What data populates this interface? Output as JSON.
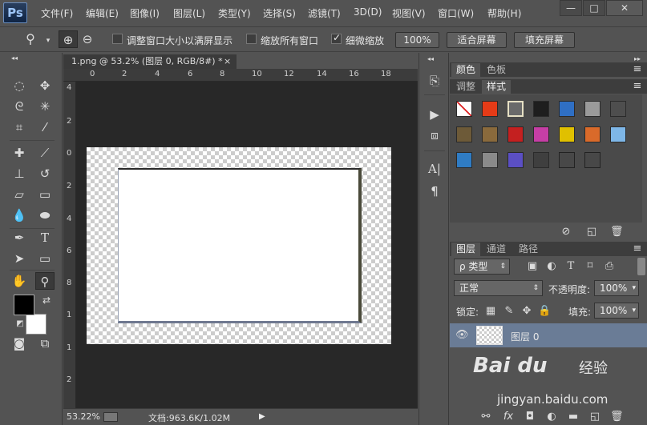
{
  "app": {
    "logo": "Ps"
  },
  "menu": [
    "文件(F)",
    "编辑(E)",
    "图像(I)",
    "图层(L)",
    "类型(Y)",
    "选择(S)",
    "滤镜(T)",
    "3D(D)",
    "视图(V)",
    "窗口(W)",
    "帮助(H)"
  ],
  "window_controls": {
    "minimize": "—",
    "maximize": "□",
    "close": "✕"
  },
  "options": {
    "resize_windows_label": "调整窗口大小以满屏显示",
    "resize_windows_checked": false,
    "zoom_all_label": "缩放所有窗口",
    "zoom_all_checked": false,
    "scrubby_zoom_label": "细微缩放",
    "scrubby_zoom_checked": true,
    "actual_pixels_button": "100%",
    "fit_screen_button": "适合屏幕",
    "fill_screen_button": "填充屏幕"
  },
  "document": {
    "tab_title": "1.png @ 53.2% (图层 0, RGB/8#) *",
    "tab_close": "×",
    "ruler_top_ticks": [
      "0",
      "2",
      "4",
      "6",
      "8",
      "10",
      "12",
      "14",
      "16",
      "18"
    ],
    "ruler_left_ticks": [
      "4",
      "2",
      "0",
      "2",
      "4",
      "6",
      "8",
      "1",
      "1",
      "2"
    ],
    "zoom_level": "53.22%",
    "doc_size": "文档:963.6K/1.02M"
  },
  "color_panel": {
    "tabs": [
      "颜色",
      "色板"
    ]
  },
  "styles_panel": {
    "tabs": [
      "调整",
      "样式"
    ],
    "swatches": [
      {
        "name": "none",
        "color": "#ffffff"
      },
      {
        "name": "glow-red",
        "color": "#e53b17"
      },
      {
        "name": "frame-grey",
        "color": "#6a6a6a"
      },
      {
        "name": "dark-button",
        "color": "#1e1e1e"
      },
      {
        "name": "blue-glass",
        "color": "#2f6fc4"
      },
      {
        "name": "silver",
        "color": "#9a9a9a"
      },
      {
        "name": "dark-metal",
        "color": "#4e4e4e"
      },
      {
        "name": "wood-dark",
        "color": "#6d5a38"
      },
      {
        "name": "wood",
        "color": "#8a6a3c"
      },
      {
        "name": "red-stripes",
        "color": "#c42020"
      },
      {
        "name": "rainbow",
        "color": "#c63ea5"
      },
      {
        "name": "gold",
        "color": "#e0c000"
      },
      {
        "name": "orange-gradient",
        "color": "#d96a2a"
      },
      {
        "name": "light-blue",
        "color": "#7eb7e8"
      },
      {
        "name": "sunset",
        "color": "#2f7cc4"
      },
      {
        "name": "checker",
        "color": "#8a8a8a"
      },
      {
        "name": "purple-blue",
        "color": "#5b4fc4"
      },
      {
        "name": "empty-dark",
        "color": "#3f3f3f"
      },
      {
        "name": "empty-outline",
        "color": "#484848"
      },
      {
        "name": "empty-outline-2",
        "color": "#484848"
      }
    ]
  },
  "layers_panel": {
    "tabs": [
      "图层",
      "通道",
      "路径"
    ],
    "filter_kind": "ρ 类型",
    "blend_mode": "正常",
    "opacity_label": "不透明度:",
    "opacity_value": "100%",
    "lock_label": "锁定:",
    "fill_label": "填充:",
    "fill_value": "100%",
    "layers": [
      {
        "name": "图层 0",
        "visible": true
      }
    ]
  },
  "watermark": {
    "brand": "Bai du",
    "cn": "经验",
    "url": "jingyan.baidu.com"
  }
}
